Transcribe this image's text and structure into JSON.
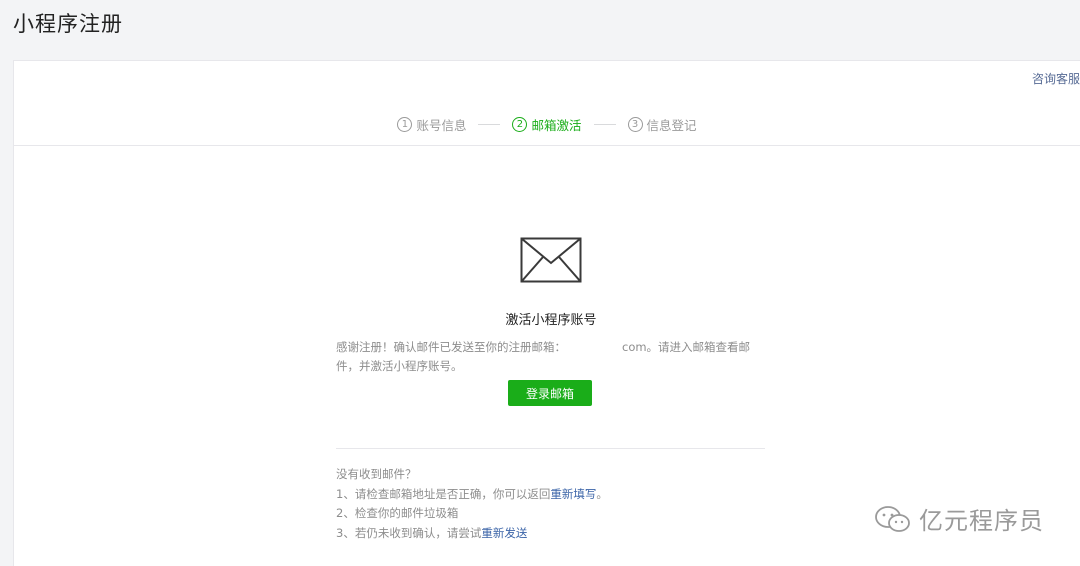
{
  "page": {
    "title": "小程序注册"
  },
  "header": {
    "help_link": "咨询客服"
  },
  "steps": [
    {
      "num": "1",
      "label": "账号信息",
      "active": false
    },
    {
      "num": "2",
      "label": "邮箱激活",
      "active": true
    },
    {
      "num": "3",
      "label": "信息登记",
      "active": false
    }
  ],
  "main": {
    "icon": "envelope-icon",
    "title": "激活小程序账号",
    "desc_prefix": "感谢注册！确认邮件已发送至你的注册邮箱：",
    "desc_suffix": "com。请进入邮箱查看邮件，并激活小程序账号。",
    "login_button": "登录邮箱"
  },
  "help": {
    "heading": "没有收到邮件？",
    "item1_text": "1、请检查邮箱地址是否正确，你可以返回",
    "item1_link": "重新填写",
    "item1_end": "。",
    "item2_text": "2、检查你的邮件垃圾箱",
    "item3_text": "3、若仍未收到确认，请尝试",
    "item3_link": "重新发送"
  },
  "watermark": {
    "text": "亿元程序员",
    "icon": "wechat-logo-icon"
  },
  "colors": {
    "accent": "#1aad19",
    "link": "#576b95",
    "background": "#f3f4f6"
  }
}
